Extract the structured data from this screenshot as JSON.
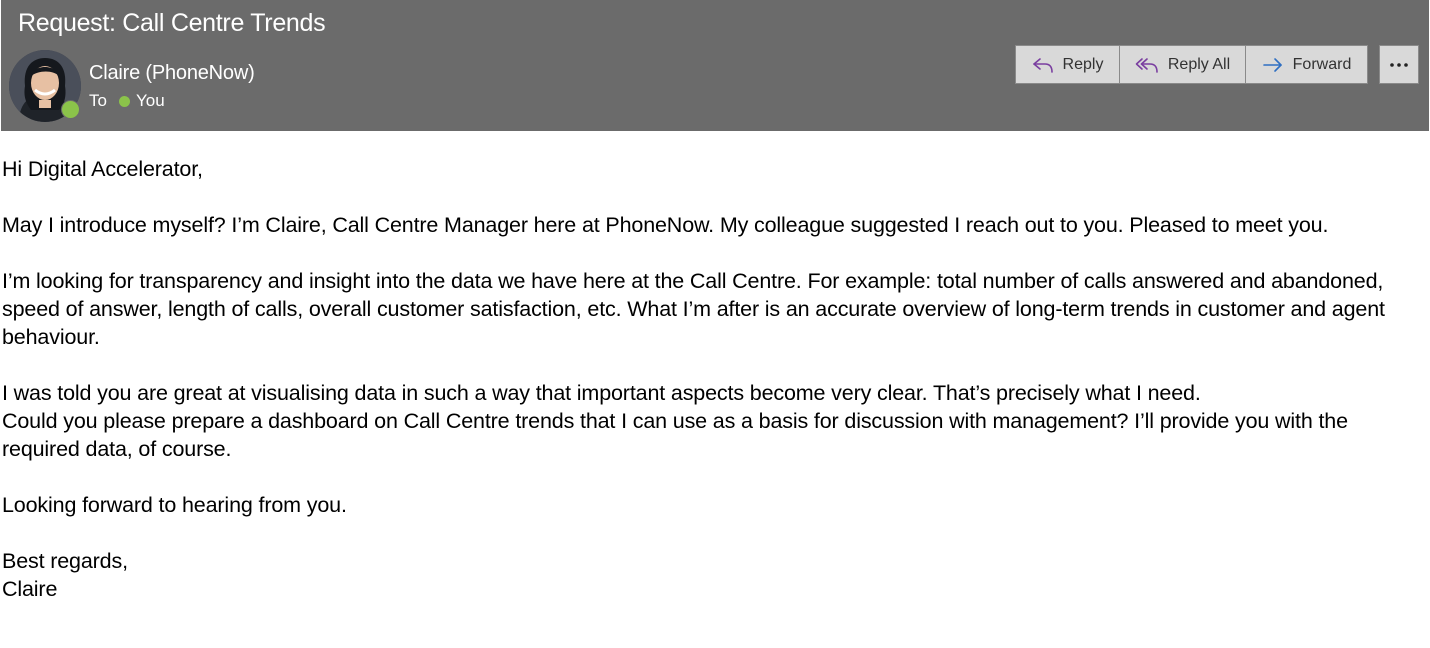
{
  "email": {
    "subject": "Request: Call Centre Trends",
    "sender": "Claire (PhoneNow)",
    "to_label": "To",
    "recipient": "You",
    "presence_color": "#8bc34a"
  },
  "actions": {
    "reply_label": "Reply",
    "reply_all_label": "Reply All",
    "forward_label": "Forward",
    "more_icon": "ellipsis-icon"
  },
  "body": {
    "greeting": "Hi Digital Accelerator,",
    "paragraph1": "May I introduce myself? I’m Claire, Call Centre Manager here at PhoneNow. My colleague suggested I reach out to you. Pleased to meet you.",
    "paragraph2": "I’m looking for transparency and insight into the data we have here at the Call Centre. For example: total number of calls answered and abandoned, speed of answer, length of calls, overall customer satisfaction, etc. What I’m after is an accurate overview of long-term trends in customer and agent behaviour.",
    "paragraph3_line1": "I was told you are great at visualising data in such a way that important aspects become very clear. That’s precisely what I need.",
    "paragraph3_line2": "Could you please prepare a dashboard on Call Centre trends that I can use as a basis for discussion with management? I’ll provide you with the required data, of course.",
    "closing_line": "Looking forward to hearing from you.",
    "sign_off": "Best regards,",
    "signature": "Claire"
  }
}
